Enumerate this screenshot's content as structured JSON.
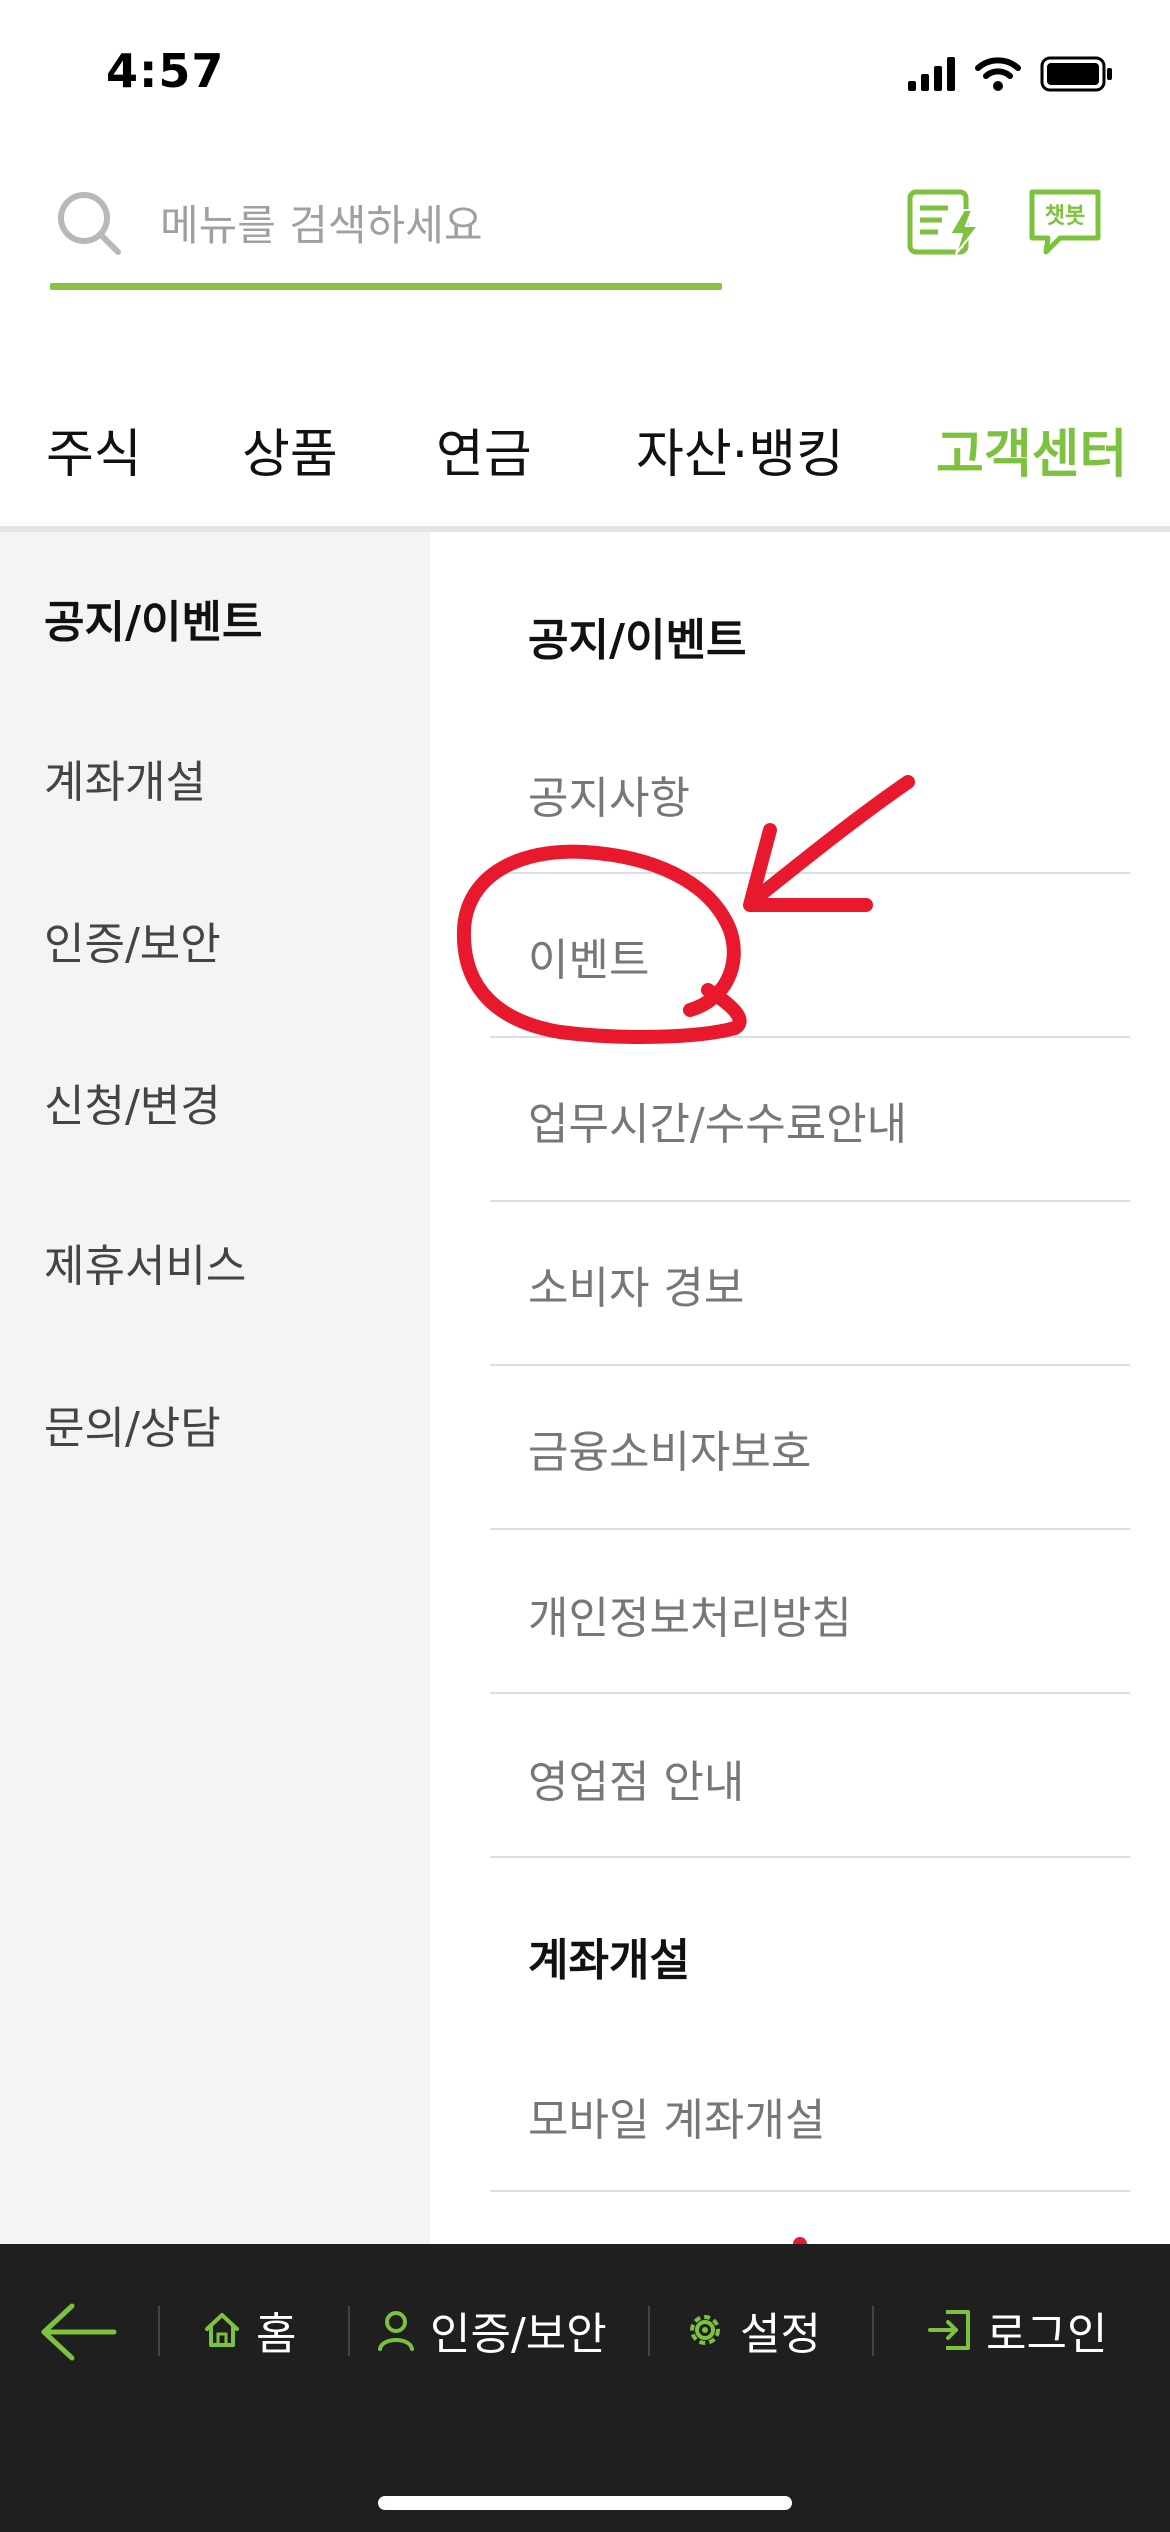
{
  "status_bar": {
    "time": "4:57"
  },
  "search": {
    "placeholder": "메뉴를 검색하세요"
  },
  "header": {
    "chatbot_label": "챗봇"
  },
  "tabs": [
    {
      "label": "주식"
    },
    {
      "label": "상품"
    },
    {
      "label": "연금"
    },
    {
      "label": "자산·뱅킹"
    },
    {
      "label": "고객센터",
      "active": true
    }
  ],
  "sidebar": {
    "items": [
      {
        "label": "공지/이벤트",
        "active": true
      },
      {
        "label": "계좌개설"
      },
      {
        "label": "인증/보안"
      },
      {
        "label": "신청/변경"
      },
      {
        "label": "제휴서비스"
      },
      {
        "label": "문의/상담"
      }
    ]
  },
  "content": {
    "sections": [
      {
        "title": "공지/이벤트",
        "items": [
          "공지사항",
          "이벤트",
          "업무시간/수수료안내",
          "소비자 경보",
          "금융소비자보호",
          "개인정보처리방침",
          "영업점 안내"
        ]
      },
      {
        "title": "계좌개설",
        "items": [
          "모바일 계좌개설"
        ]
      }
    ]
  },
  "bottom_bar": {
    "home": "홈",
    "auth": "인증/보안",
    "settings": "설정",
    "login": "로그인"
  },
  "colors": {
    "accent": "#7cc23e",
    "annotation": "#e8192c",
    "bottom_bar": "#1f1f1f",
    "sidebar_bg": "#f4f4f4"
  }
}
